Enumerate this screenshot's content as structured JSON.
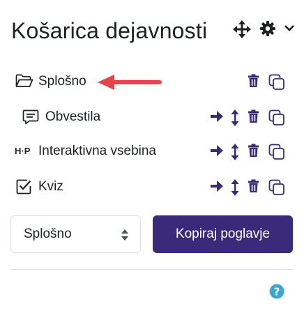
{
  "header": {
    "title": "Košarica dejavnosti",
    "icons": [
      "move-icon",
      "gear-icon",
      "chevron-down-icon"
    ]
  },
  "items": [
    {
      "label": "Splošno",
      "icon": "folder-open-icon",
      "actions": [
        "delete-icon",
        "copy-icon"
      ]
    },
    {
      "label": "Obvestila",
      "icon": "forum-comment-icon",
      "actions": [
        "move-to-icon",
        "reorder-icon",
        "delete-icon",
        "copy-icon"
      ]
    },
    {
      "label": "Interaktivna vsebina",
      "icon_text": "H·P",
      "icon": "h5p-icon",
      "actions": [
        "move-to-icon",
        "reorder-icon",
        "delete-icon",
        "copy-icon"
      ]
    },
    {
      "label": "Kviz",
      "icon": "quiz-checkbox-icon",
      "actions": [
        "move-to-icon",
        "reorder-icon",
        "delete-icon",
        "copy-icon"
      ]
    }
  ],
  "section_select": {
    "value": "Splošno"
  },
  "copy_button": {
    "label": "Kopiraj poglavje"
  },
  "help_icon": "question-circle-icon",
  "colors": {
    "primary": "#3a2b7a",
    "annotation": "#e84348",
    "help": "#3aa6d3",
    "text": "#1d2125"
  }
}
